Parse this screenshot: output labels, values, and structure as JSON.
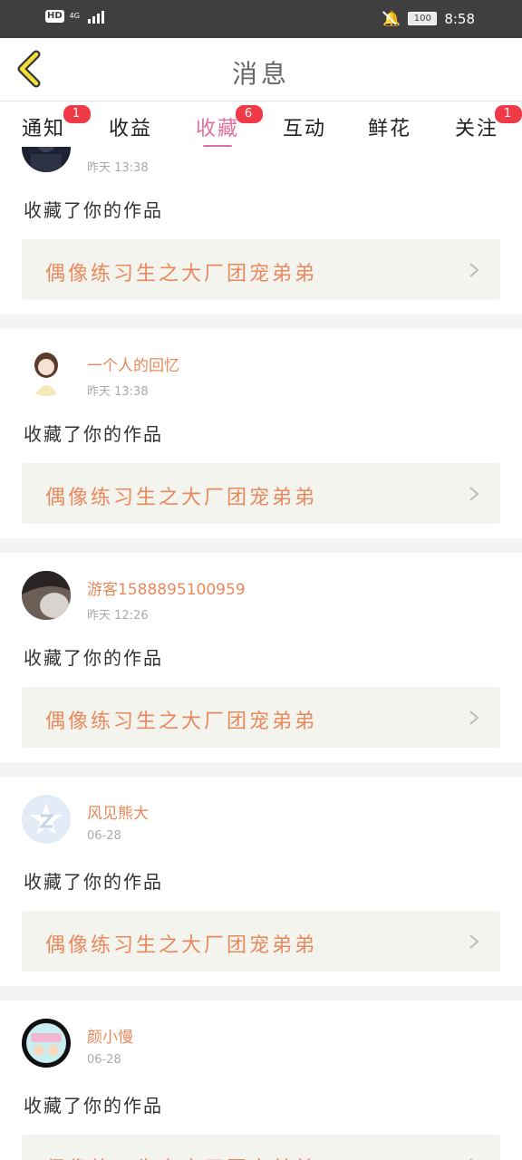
{
  "status_bar": {
    "hd": "HD",
    "network": "4G",
    "battery": "100",
    "time": "8:58"
  },
  "header": {
    "title": "消息"
  },
  "tabs": [
    {
      "label": "通知",
      "badge": "1"
    },
    {
      "label": "收益",
      "badge": ""
    },
    {
      "label": "收藏",
      "badge": "6"
    },
    {
      "label": "互动",
      "badge": ""
    },
    {
      "label": "鲜花",
      "badge": ""
    },
    {
      "label": "关注",
      "badge": "1"
    }
  ],
  "colors": {
    "accent": "#e06fa0",
    "badge": "#ef3a48",
    "username": "#e8895d",
    "work_bg": "#f4f4ee"
  },
  "messages": [
    {
      "user": "",
      "time": "昨天 13:38",
      "action": "收藏了你的作品",
      "work": "偶像练习生之大厂团宠弟弟",
      "avatar": "dark-avatar"
    },
    {
      "user": "一个人的回忆",
      "time": "昨天 13:38",
      "action": "收藏了你的作品",
      "work": "偶像练习生之大厂团宠弟弟",
      "avatar": "anime-girl-avatar"
    },
    {
      "user": "游客1588895100959",
      "time": "昨天 12:26",
      "action": "收藏了你的作品",
      "work": "偶像练习生之大厂团宠弟弟",
      "avatar": "photo-avatar"
    },
    {
      "user": "风见熊大",
      "time": "06-28",
      "action": "收藏了你的作品",
      "work": "偶像练习生之大厂团宠弟弟",
      "avatar": "default-avatar"
    },
    {
      "user": "颜小慢",
      "time": "06-28",
      "action": "收藏了你的作品",
      "work": "偶像练习生之大厂团宠弟弟",
      "avatar": "cartoon-avatar"
    }
  ]
}
